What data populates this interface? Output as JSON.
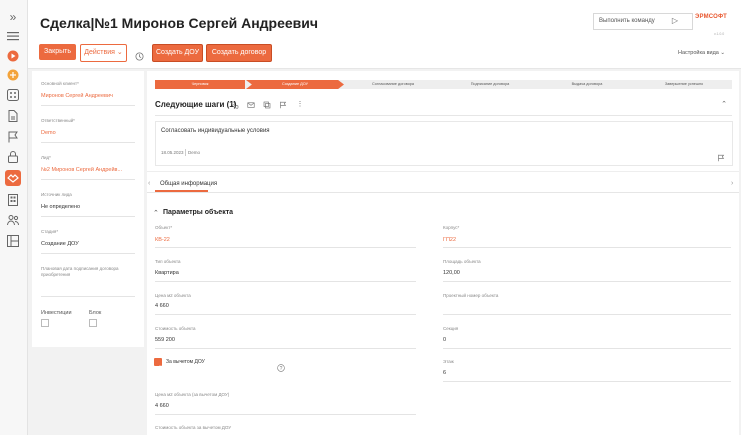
{
  "header": {
    "title": "Сделка|№1 Миронов Сергей Андреевич",
    "command_placeholder": "Выполнить команду",
    "logo": "ЭРМСОФТ",
    "version": "v.1.0.0",
    "view_settings": "Настройка вида ⌄"
  },
  "toolbar": {
    "close": "Закрыть",
    "actions": "Действия ⌄",
    "create_ddu": "Создать ДОУ",
    "create_contract": "Создать договор"
  },
  "left_panel": {
    "fields": [
      {
        "label": "Основной клиент*",
        "value": "Миронов Сергей Андреевич"
      },
      {
        "label": "Ответственный*",
        "value": "Demo"
      },
      {
        "label": "Лид*",
        "value": "№2 Миронов Сергей Андрейв..."
      },
      {
        "label": "Источник лида",
        "value": "Не определено"
      },
      {
        "label": "Стадия*",
        "value": "Создание ДОУ"
      },
      {
        "label": "Плановая дата подписания договора приобретения",
        "value": ""
      }
    ],
    "investments_label": "Инвестиции",
    "block_label": "Блок"
  },
  "stages": [
    {
      "label": "Черновик",
      "active": true
    },
    {
      "label": "Создание ДОУ",
      "active": true
    },
    {
      "label": "Согласование договора",
      "active": false
    },
    {
      "label": "Подписание договора",
      "active": false
    },
    {
      "label": "Выдача договора",
      "active": false
    },
    {
      "label": "Завершение успешно",
      "active": false
    }
  ],
  "next_steps": {
    "title": "Следующие шаги (1)",
    "task_text": "Согласовать индивидуальные условия",
    "task_date": "18.05.2023",
    "task_user": "Demo"
  },
  "tabs": {
    "general": "Общая информация"
  },
  "object_section": {
    "title": "Параметры объекта",
    "left": [
      {
        "label": "Объект*",
        "value": "КВ-22",
        "orange": true
      },
      {
        "label": "Тип объекта",
        "value": "Квартира",
        "orange": false
      },
      {
        "label": "Цена м2 объекта",
        "value": "4 660",
        "orange": false
      },
      {
        "label": "Стоимость объекта",
        "value": "559 200",
        "orange": false
      }
    ],
    "right": [
      {
        "label": "Корпус*",
        "value": "ГП22",
        "orange": true
      },
      {
        "label": "Площадь объекта",
        "value": "120,00",
        "orange": false
      },
      {
        "label": "Проектный номер объекта",
        "value": "",
        "orange": false
      },
      {
        "label": "Секция",
        "value": "0",
        "orange": false
      },
      {
        "label": "Этаж",
        "value": "6",
        "orange": false
      }
    ],
    "minus_ddu_label": "За вычетом ДОУ",
    "minus_ddu_checked": true,
    "price_minus_label": "Цена м2 объекта (за вычетом ДОУ)",
    "price_minus_value": "4 660",
    "cost_minus_label": "Стоимость объекта за вычетом ДОУ"
  }
}
